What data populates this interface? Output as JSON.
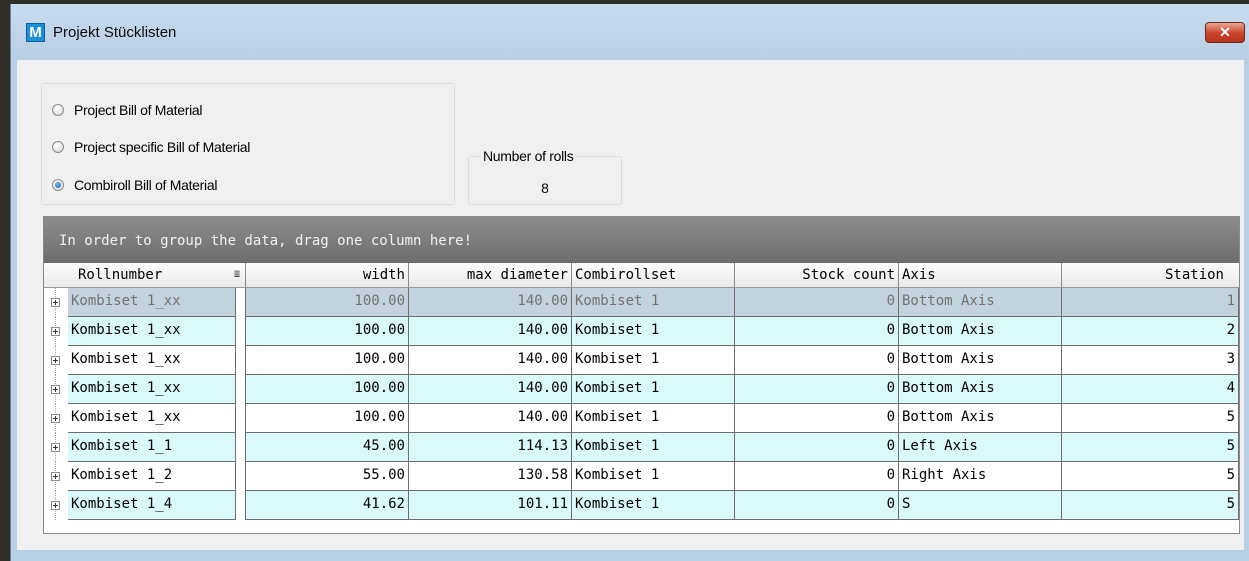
{
  "window": {
    "title": "Projekt Stücklisten",
    "app_icon_letter": "M",
    "close_label": "✕"
  },
  "bom_options": {
    "items": [
      {
        "label": "Project Bill of Material",
        "checked": false
      },
      {
        "label": "Project specific Bill of Material",
        "checked": false
      },
      {
        "label": "Combiroll Bill of Material",
        "checked": true
      }
    ]
  },
  "rolls": {
    "label": "Number of rolls",
    "value": "8"
  },
  "grid": {
    "group_panel_hint": "In order to group the data, drag one column here!",
    "columns": [
      "Rollnumber",
      "width",
      "max diameter",
      "Combirollset",
      "Stock count",
      "Axis",
      "Station"
    ],
    "rows": [
      [
        "Kombiset 1_xx",
        "100.00",
        "140.00",
        "Kombiset 1",
        "0",
        "Bottom Axis",
        "1"
      ],
      [
        "Kombiset 1_xx",
        "100.00",
        "140.00",
        "Kombiset 1",
        "0",
        "Bottom Axis",
        "2"
      ],
      [
        "Kombiset 1_xx",
        "100.00",
        "140.00",
        "Kombiset 1",
        "0",
        "Bottom Axis",
        "3"
      ],
      [
        "Kombiset 1_xx",
        "100.00",
        "140.00",
        "Kombiset 1",
        "0",
        "Bottom Axis",
        "4"
      ],
      [
        "Kombiset 1_xx",
        "100.00",
        "140.00",
        "Kombiset 1",
        "0",
        "Bottom Axis",
        "5"
      ],
      [
        "Kombiset 1_1",
        "45.00",
        "114.13",
        "Kombiset 1",
        "0",
        "Left Axis",
        "5"
      ],
      [
        "Kombiset 1_2",
        "55.00",
        "130.58",
        "Kombiset 1",
        "0",
        "Right Axis",
        "5"
      ],
      [
        "Kombiset 1_4",
        "41.62",
        "101.11",
        "Kombiset 1",
        "0",
        "S",
        "5"
      ]
    ],
    "selected_row": 0
  },
  "colors": {
    "row_alt": "#d9f9fb",
    "row_selected": "#c3d3de",
    "group_panel": "#7a7a7a",
    "title_bar": "#b9cfe4"
  }
}
